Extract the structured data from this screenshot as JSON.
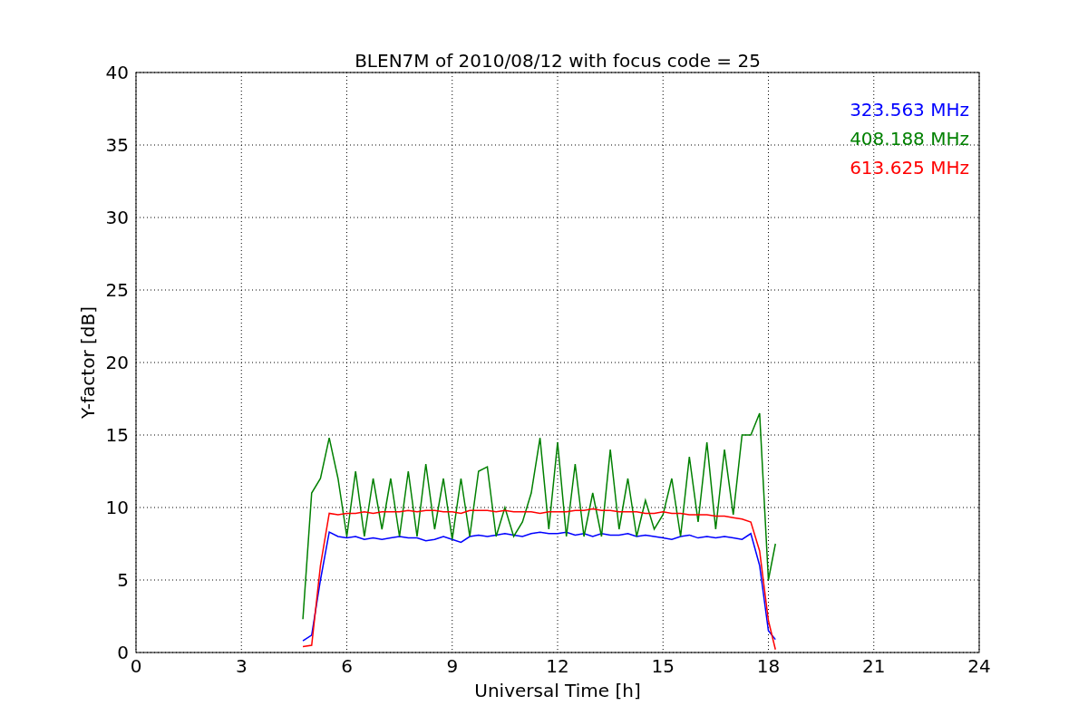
{
  "chart_data": {
    "type": "line",
    "title": "BLEN7M of 2010/08/12 with focus code = 25",
    "xlabel": "Universal Time [h]",
    "ylabel": "Y-factor [dB]",
    "x": [
      4.75,
      5,
      5.25,
      5.5,
      5.75,
      6,
      6.25,
      6.5,
      6.75,
      7,
      7.25,
      7.5,
      7.75,
      8,
      8.25,
      8.5,
      8.75,
      9,
      9.25,
      9.5,
      9.75,
      10,
      10.25,
      10.5,
      10.75,
      11,
      11.25,
      11.5,
      11.75,
      12,
      12.25,
      12.5,
      12.75,
      13,
      13.25,
      13.5,
      13.75,
      14,
      14.25,
      14.5,
      14.75,
      15,
      15.25,
      15.5,
      15.75,
      16,
      16.25,
      16.5,
      16.75,
      17,
      17.25,
      17.5,
      17.75,
      18,
      18.2
    ],
    "series": [
      {
        "name": "323.563 MHz",
        "color": "#0000ff",
        "values": [
          0.8,
          1.2,
          5,
          8.3,
          8,
          7.9,
          8,
          7.8,
          7.9,
          7.8,
          7.9,
          8,
          7.9,
          7.9,
          7.7,
          7.8,
          8,
          7.8,
          7.6,
          8,
          8.1,
          8,
          8.1,
          8.2,
          8.1,
          8,
          8.2,
          8.3,
          8.2,
          8.2,
          8.3,
          8.1,
          8.2,
          8,
          8.2,
          8.1,
          8.1,
          8.2,
          8,
          8.1,
          8,
          7.9,
          7.8,
          8,
          8.1,
          7.9,
          8,
          7.9,
          8,
          7.9,
          7.8,
          8.2,
          6,
          1.5,
          0.9
        ]
      },
      {
        "name": "408.188 MHz",
        "color": "#008000",
        "values": [
          2.3,
          11,
          12,
          14.8,
          12,
          8,
          12.5,
          8,
          12,
          8.5,
          12,
          8,
          12.5,
          8,
          13,
          8.5,
          12,
          7.8,
          12,
          8,
          12.5,
          12.8,
          8,
          10,
          8,
          9,
          11,
          14.8,
          8.5,
          14.5,
          8,
          13,
          8,
          11,
          8,
          14,
          8.5,
          12,
          8,
          10.5,
          8.5,
          9.5,
          12,
          8,
          13.5,
          9,
          14.5,
          8.5,
          14,
          9.5,
          15,
          15,
          16.5,
          5,
          7.5
        ]
      },
      {
        "name": "613.625 MHz",
        "color": "#ff0000",
        "values": [
          0.4,
          0.5,
          6,
          9.6,
          9.5,
          9.6,
          9.6,
          9.7,
          9.6,
          9.7,
          9.7,
          9.7,
          9.8,
          9.7,
          9.8,
          9.8,
          9.7,
          9.7,
          9.6,
          9.8,
          9.8,
          9.8,
          9.7,
          9.8,
          9.7,
          9.7,
          9.7,
          9.6,
          9.7,
          9.7,
          9.7,
          9.8,
          9.8,
          9.9,
          9.8,
          9.8,
          9.7,
          9.7,
          9.7,
          9.6,
          9.6,
          9.7,
          9.6,
          9.6,
          9.5,
          9.5,
          9.5,
          9.4,
          9.4,
          9.3,
          9.2,
          9,
          7,
          2.2,
          0.2
        ]
      }
    ],
    "grid": true,
    "xlim": [
      0,
      24
    ],
    "ylim": [
      0,
      40
    ],
    "xticks": [
      0,
      3,
      6,
      9,
      12,
      15,
      18,
      21,
      24
    ],
    "yticks": [
      0,
      5,
      10,
      15,
      20,
      25,
      30,
      35,
      40
    ]
  }
}
